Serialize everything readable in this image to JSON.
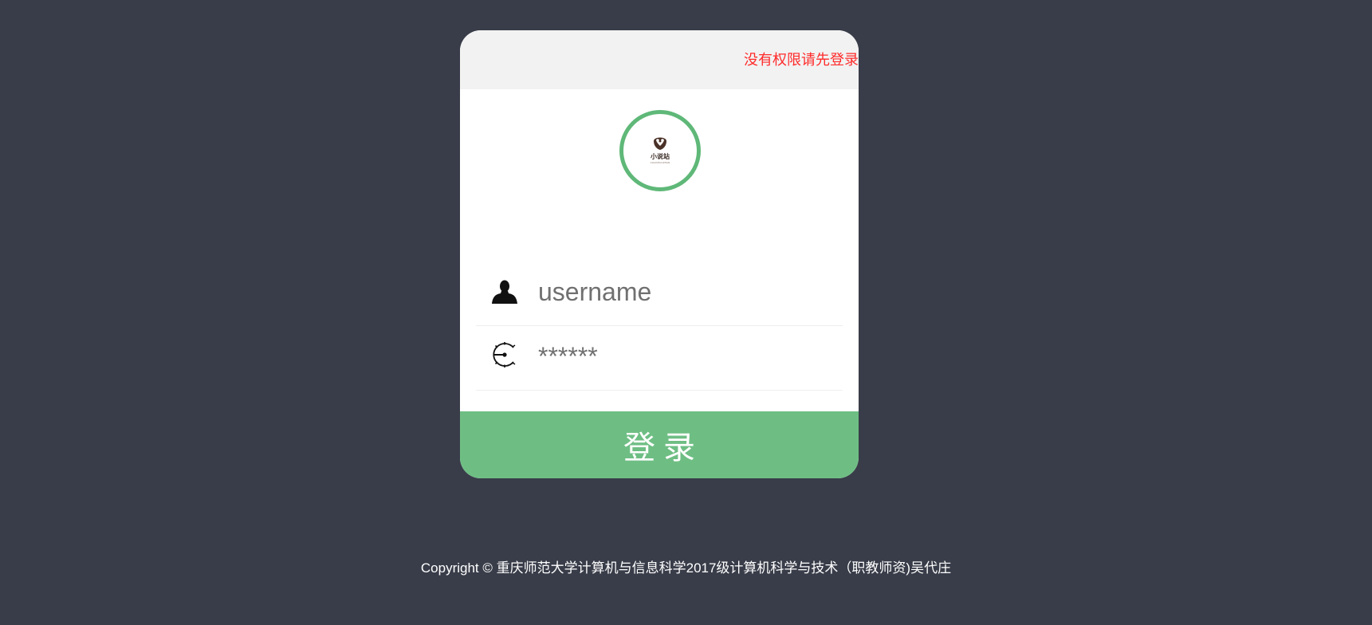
{
  "header": {
    "notice": "没有权限请先登录"
  },
  "logo": {
    "name": "小说站",
    "subtitle": "XIAOSHUOZHAN",
    "ring_color": "#5fb878"
  },
  "form": {
    "username": {
      "placeholder": "username",
      "value": "",
      "icon": "user-icon"
    },
    "password": {
      "placeholder": "******",
      "value": "",
      "icon": "lock-dial-icon"
    },
    "submit_label": "登录"
  },
  "footer": {
    "copyright": "Copyright © 重庆师范大学计算机与信息科学2017级计算机科学与技术（职教师资)吴代庄"
  },
  "colors": {
    "background": "#393d49",
    "accent": "#6ebe84",
    "notice": "#ff2a2a"
  }
}
